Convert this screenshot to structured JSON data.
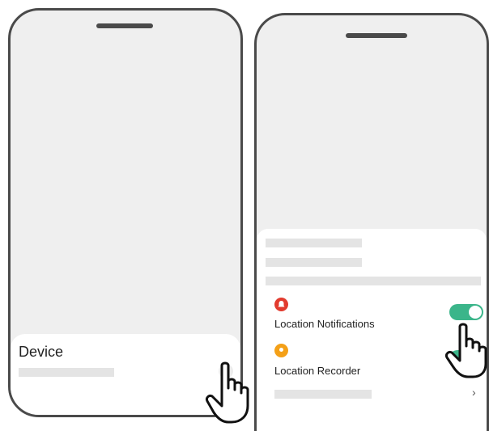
{
  "left_screen": {
    "section_title": "Device",
    "chevron": "›"
  },
  "right_screen": {
    "items": [
      {
        "label": "Location Notifications",
        "icon": "bell-icon",
        "icon_color": "#e23b2e",
        "toggle_on": true
      },
      {
        "label": "Location Recorder",
        "icon": "location-pin-icon",
        "icon_color": "#f4a017",
        "toggle_on": true
      }
    ],
    "chevron": "›"
  },
  "colors": {
    "toggle_on": "#3bb58a",
    "phone_bg": "#efefef",
    "phone_frame": "#4a4a4a"
  }
}
